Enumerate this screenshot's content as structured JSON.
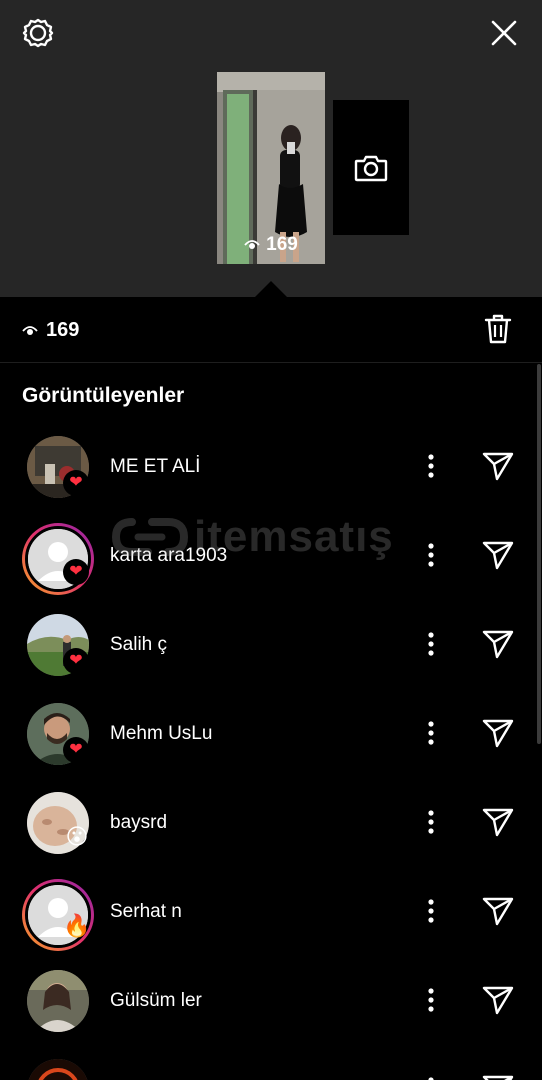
{
  "header": {
    "settings_icon": "settings-gear-icon",
    "close_icon": "close-x-icon"
  },
  "story": {
    "views": "169",
    "camera_icon": "camera-icon"
  },
  "summary": {
    "views": "169",
    "delete_icon": "trash-icon"
  },
  "viewers_section": {
    "title": "Görüntüleyenler"
  },
  "viewers": [
    {
      "username": "ME      ET ALİ",
      "reaction": "heart",
      "ringed": false
    },
    {
      "username": "karta    ara1903",
      "reaction": "heart",
      "ringed": true
    },
    {
      "username": "Salih   ç",
      "reaction": "heart",
      "ringed": false
    },
    {
      "username": "Mehm    UsLu",
      "reaction": "heart",
      "ringed": false
    },
    {
      "username": "baysrd",
      "reaction": "😮",
      "ringed": false
    },
    {
      "username": "Serhat    n",
      "reaction": "🔥",
      "ringed": true
    },
    {
      "username": "Gülsüm    ler",
      "reaction": "",
      "ringed": false
    }
  ],
  "watermark": {
    "text": "itemsatış"
  },
  "colors": {
    "background": "#000000",
    "top_background": "#262626",
    "heart": "#ff3040"
  }
}
